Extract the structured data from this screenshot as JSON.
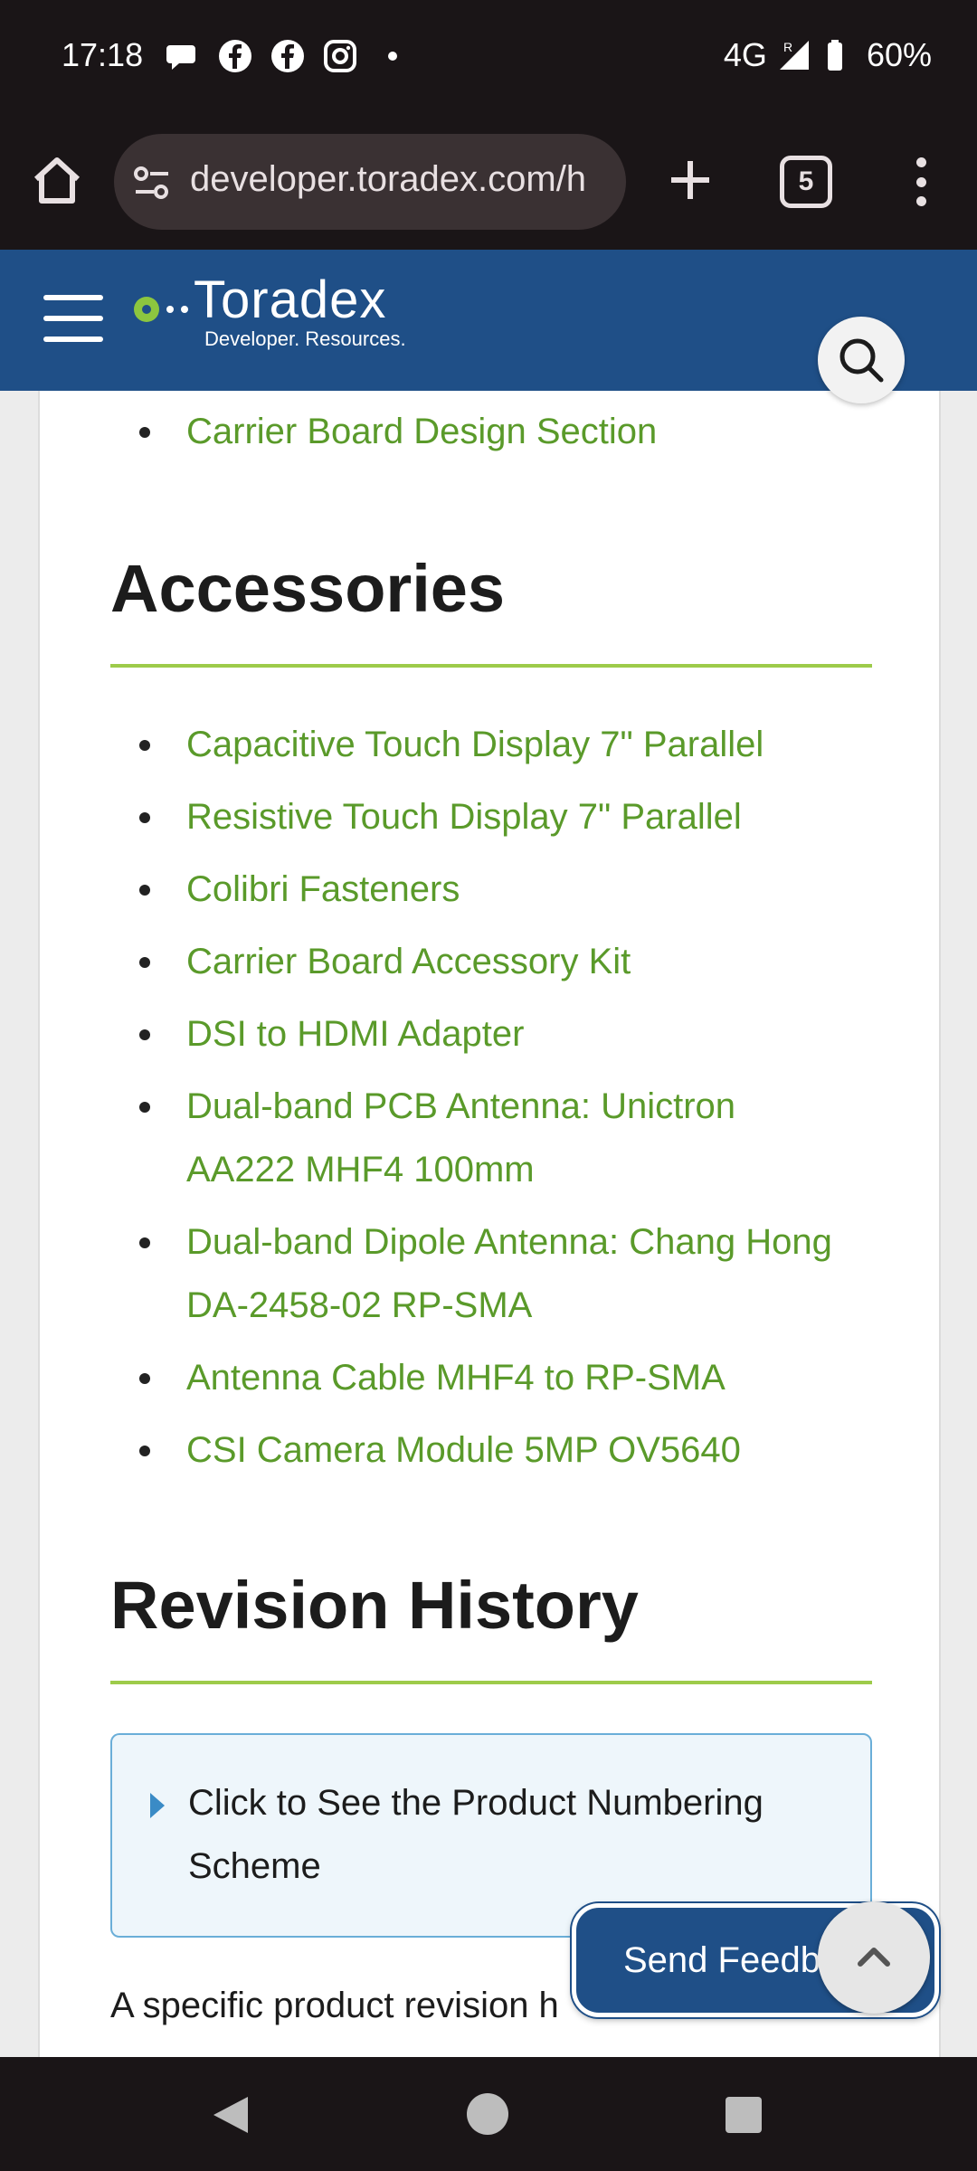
{
  "status_bar": {
    "time": "17:18",
    "network": "4G",
    "battery": "60%",
    "left_icons": [
      "chat-icon",
      "facebook-icon",
      "facebook-icon",
      "instagram-icon",
      "dot-icon"
    ],
    "right_icons": [
      "signal-icon",
      "battery-icon"
    ]
  },
  "browser": {
    "url": "developer.toradex.com/h",
    "tab_count": "5"
  },
  "site": {
    "logo_text": "Toradex",
    "logo_subtitle": "Developer. Resources.",
    "brand_color": "#1f4f87",
    "accent_color": "#9dcb4a",
    "link_color": "#5a9a2a"
  },
  "content": {
    "top_link": "Carrier Board Design Section",
    "accessories_heading": "Accessories",
    "accessories": [
      "Capacitive Touch Display 7\" Parallel",
      "Resistive Touch Display 7\" Parallel",
      "Colibri Fasteners",
      "Carrier Board Accessory Kit",
      "DSI to HDMI Adapter",
      "Dual-band PCB Antenna: Unictron AA222 MHF4 100mm",
      "Dual-band Dipole Antenna: Chang Hong DA-2458-02 RP-SMA",
      "Antenna Cable MHF4 to RP-SMA",
      "CSI Camera Module 5MP OV5640"
    ],
    "revision_heading": "Revision History",
    "details_summary": "Click to See the Product Numbering Scheme",
    "paragraph": "A specific product revision h"
  },
  "floating": {
    "feedback_label": "Send Feedb"
  }
}
